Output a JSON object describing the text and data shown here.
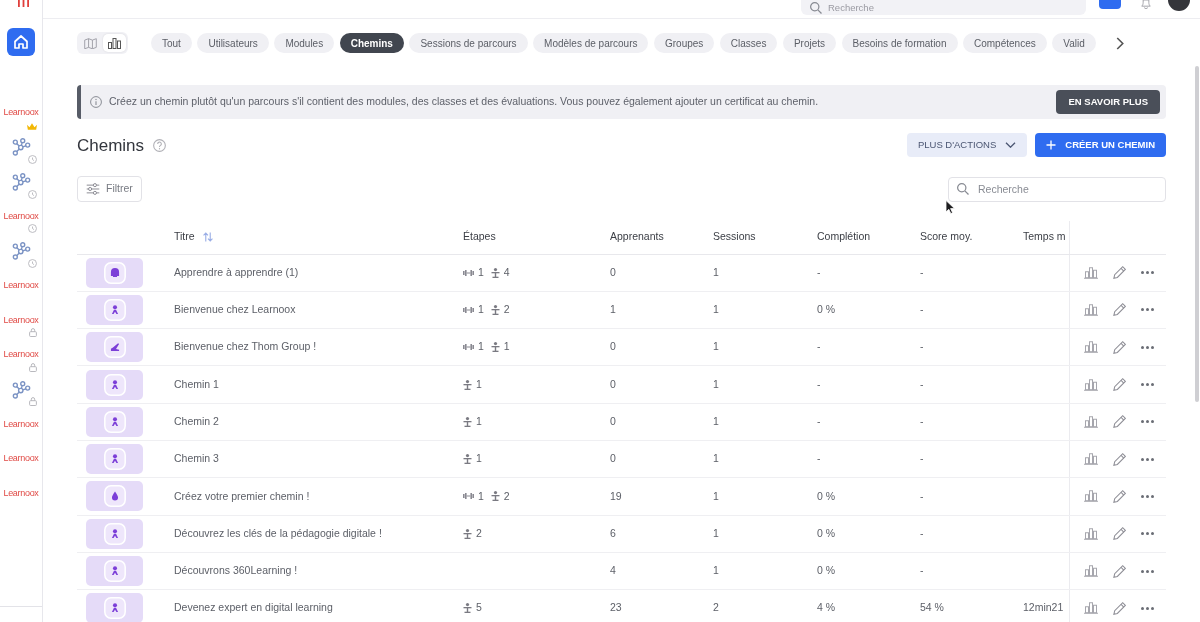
{
  "topbar": {
    "search": {
      "placeholder": "Recherche"
    }
  },
  "sidebar": {
    "home": {
      "selected": true
    },
    "items": [
      {
        "kind": "logo",
        "label": "Learnoox",
        "badge": {
          "kind": "crown"
        },
        "selected": false
      },
      {
        "kind": "network",
        "badge": {
          "kind": "clock"
        },
        "selected": false
      },
      {
        "kind": "network",
        "badge": {
          "kind": "clock"
        },
        "selected": false
      },
      {
        "kind": "logo",
        "label": "Learnoox",
        "badge": {
          "kind": "clock"
        },
        "selected": false
      },
      {
        "kind": "network",
        "badge": {
          "kind": "clock"
        },
        "selected": false
      },
      {
        "kind": "logo",
        "label": "Learnoox",
        "selected": false
      },
      {
        "kind": "logo",
        "label": "Learnoox",
        "badge": {
          "kind": "lock"
        },
        "selected": false
      },
      {
        "kind": "logo",
        "label": "Learnoox",
        "badge": {
          "kind": "lock"
        },
        "selected": false
      },
      {
        "kind": "network",
        "badge": {
          "kind": "lock"
        },
        "selected": false
      },
      {
        "kind": "logo",
        "label": "Learnoox",
        "selected": false
      },
      {
        "kind": "logo",
        "label": "Learnoox",
        "selected": false
      },
      {
        "kind": "logo",
        "label": "Learnoox",
        "selected": false
      }
    ]
  },
  "view_toggle": [
    {
      "kind": "book",
      "selected": false
    },
    {
      "kind": "chart",
      "selected": true
    }
  ],
  "filter_tabs": [
    {
      "label": "Tout",
      "selected": false
    },
    {
      "label": "Utilisateurs",
      "selected": false
    },
    {
      "label": "Modules",
      "selected": false
    },
    {
      "label": "Chemins",
      "selected": true
    },
    {
      "label": "Sessions de parcours",
      "selected": false
    },
    {
      "label": "Modèles de parcours",
      "selected": false
    },
    {
      "label": "Groupes",
      "selected": false
    },
    {
      "label": "Classes",
      "selected": false
    },
    {
      "label": "Projets",
      "selected": false
    },
    {
      "label": "Besoins de formation",
      "selected": false
    },
    {
      "label": "Compétences",
      "selected": false
    },
    {
      "label": "Valid",
      "selected": false
    }
  ],
  "info_banner": {
    "text": "Créez un chemin plutôt qu'un parcours s'il contient des modules, des classes et des évaluations. Vous pouvez également ajouter un certificat au chemin.",
    "button": "EN SAVOIR PLUS"
  },
  "header": {
    "title": "Chemins",
    "more_actions": "PLUS D'ACTIONS",
    "create": "CRÉER UN CHEMIN"
  },
  "toolbar": {
    "filter": "Filtrer",
    "search": {
      "placeholder": "Recherche"
    }
  },
  "table": {
    "columns": [
      {
        "label": "Titre",
        "sort": true
      },
      {
        "label": "Étapes"
      },
      {
        "label": "Apprenants"
      },
      {
        "label": "Sessions"
      },
      {
        "label": "Complétion"
      },
      {
        "label": "Score moy."
      },
      {
        "label": "Temps m"
      }
    ],
    "rows": [
      {
        "kind": "brain",
        "title": "Apprendre à apprendre (1)",
        "steps": [
          {
            "kind": "module",
            "count": "1"
          },
          {
            "kind": "trainer",
            "count": "4"
          }
        ],
        "learners": "0",
        "sessions": "1",
        "completion": "-",
        "score": "-"
      },
      {
        "kind": "person",
        "title": "Bienvenue chez Learnoox",
        "steps": [
          {
            "kind": "module",
            "count": "1"
          },
          {
            "kind": "trainer",
            "count": "2"
          }
        ],
        "learners": "1",
        "sessions": "1",
        "completion": "0 %",
        "score": "-"
      },
      {
        "kind": "hand",
        "title": "Bienvenue chez Thom Group !",
        "steps": [
          {
            "kind": "module",
            "count": "1"
          },
          {
            "kind": "trainer",
            "count": "1"
          }
        ],
        "learners": "0",
        "sessions": "1",
        "completion": "-",
        "score": "-"
      },
      {
        "kind": "person",
        "title": "Chemin 1",
        "steps": [
          {
            "kind": "trainer",
            "count": "1"
          }
        ],
        "learners": "0",
        "sessions": "1",
        "completion": "-",
        "score": "-"
      },
      {
        "kind": "person",
        "title": "Chemin 2",
        "steps": [
          {
            "kind": "trainer",
            "count": "1"
          }
        ],
        "learners": "0",
        "sessions": "1",
        "completion": "-",
        "score": "-"
      },
      {
        "kind": "person",
        "title": "Chemin 3",
        "steps": [
          {
            "kind": "trainer",
            "count": "1"
          }
        ],
        "learners": "0",
        "sessions": "1",
        "completion": "-",
        "score": "-"
      },
      {
        "kind": "drop",
        "title": "Créez votre premier chemin !",
        "steps": [
          {
            "kind": "module",
            "count": "1"
          },
          {
            "kind": "trainer",
            "count": "2"
          }
        ],
        "learners": "19",
        "sessions": "1",
        "completion": "0 %",
        "score": "-"
      },
      {
        "kind": "person",
        "title": "Découvrez les clés de la pédagogie digitale !",
        "steps": [
          {
            "kind": "trainer",
            "count": "2"
          }
        ],
        "learners": "6",
        "sessions": "1",
        "completion": "0 %",
        "score": "-"
      },
      {
        "kind": "person",
        "title": "Découvrons 360Learning !",
        "learners": "4",
        "sessions": "1",
        "completion": "0 %",
        "score": "-"
      },
      {
        "kind": "person",
        "title": "Devenez expert en digital learning",
        "steps": [
          {
            "kind": "trainer",
            "count": "5"
          }
        ],
        "learners": "23",
        "sessions": "2",
        "completion": "4 %",
        "score": "54 %",
        "time": "12min21"
      }
    ]
  }
}
